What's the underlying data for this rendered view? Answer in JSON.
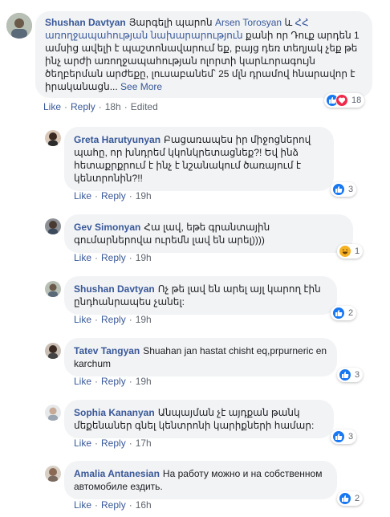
{
  "comments": [
    {
      "author": "Shushan Davtyan",
      "text_before": "Յարգելի պարոն ",
      "tag1": "Arsen Torosyan",
      "text_mid": " և ",
      "tag2": "ՀՀ առողջապահության նախարարություն",
      "text_after": " քանի որ Դուք արդեն 1 ամսից ավելի է պաշտոնավարում եք, բայց դեռ տեղյակ չեք թե ինչ արժի առողջապահության ոլորտի կարևորագույն ծեղբերման արժեքը, լուսաբանեմ՝ 25 մլն դրամով հնարավոր է իրականացն...",
      "see_more": "See More",
      "like": "Like",
      "reply": "Reply",
      "time": "18h",
      "edited": "Edited",
      "reactions": [
        "like-icon",
        "love-icon"
      ],
      "count": "18"
    },
    {
      "author": "Greta Harutyunyan",
      "text": "Բացառապես իր միջոցներով պահը, որ խնդրեմ կկոնկրետացնեք?! Եվ ինձ հետաքրքրում է ինչ է նշանակում ծառայում է կենտրոնին?!!",
      "like": "Like",
      "reply": "Reply",
      "time": "19h",
      "reactions": [
        "like-icon"
      ],
      "count": "3"
    },
    {
      "author": "Gev Simonyan",
      "text": "Հա լավ, եթե գրանտային գումարներովա ուրեմն լավ են արել))))",
      "like": "Like",
      "reply": "Reply",
      "time": "19h",
      "reactions": [
        "haha-icon"
      ],
      "count": "1"
    },
    {
      "author": "Shushan Davtyan",
      "text": "Ոչ թե լավ են արել այլ կարող էին ընդհանրապես չանել:",
      "like": "Like",
      "reply": "Reply",
      "time": "19h",
      "reactions": [
        "like-icon"
      ],
      "count": "2"
    },
    {
      "author": "Tatev Tangyan",
      "text": "Shuahan jan hastat chisht eq,prpurneric en karchum",
      "like": "Like",
      "reply": "Reply",
      "time": "19h",
      "reactions": [
        "like-icon"
      ],
      "count": "3"
    },
    {
      "author": "Sophia Kananyan",
      "text": "Անպայման չէ այդքան թանկ մեքենաներ գնել կենտրոնի կարիքների համար:",
      "like": "Like",
      "reply": "Reply",
      "time": "17h",
      "reactions": [
        "like-icon"
      ],
      "count": "3"
    },
    {
      "author": "Amalia Antanesian",
      "text": "На работу можно и на собственном автомобиле ездить.",
      "like": "Like",
      "reply": "Reply",
      "time": "16h",
      "reactions": [
        "like-icon"
      ],
      "count": "2"
    }
  ],
  "colors": {
    "link": "#385898",
    "bubble": "#f2f3f5",
    "meta": "#606770",
    "like_blue": "#1877f2",
    "love_red": "#f0284a",
    "haha_yellow": "#f7b125"
  }
}
